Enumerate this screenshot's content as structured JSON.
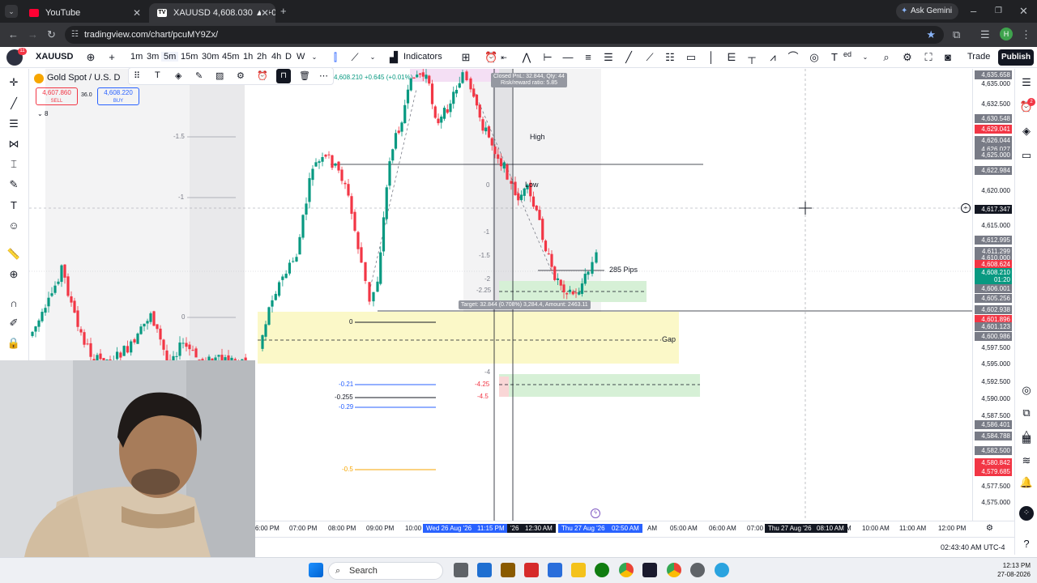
{
  "browser": {
    "tabs": [
      {
        "title": "YouTube",
        "active": false
      },
      {
        "title": "XAUUSD 4,608.030 ▲ +0.29% U",
        "active": true
      }
    ],
    "url": "tradingview.com/chart/pcuMY9Zx/",
    "gemini": "Ask Gemini",
    "profile_initial": "H"
  },
  "toolbar": {
    "symbol": "XAUUSD",
    "timeframes": [
      "1m",
      "3m",
      "5m",
      "15m",
      "30m",
      "45m",
      "1h",
      "2h",
      "4h",
      "D",
      "W"
    ],
    "active_timeframe": "5m",
    "indicators": "Indicators",
    "trade": "Trade",
    "publish": "Publish",
    "partial_label": "ed"
  },
  "legend": {
    "title": "Gold Spot / U.S. D",
    "ohlc_tail": "4,608.210 +0.645 (+0.01%)",
    "sell_price": "4,607.860",
    "sell_label": "SELL",
    "spread": "36.0",
    "buy_price": "4,608.220",
    "buy_label": "BUY",
    "collapse_count": "8"
  },
  "chart": {
    "position_info": [
      "Closed PnL: 32.844, Qty: 44",
      "Risk/reward ratio: 5.85"
    ],
    "target_info": "Target: 32.844 (0.708%) 3,284.4, Amount: 2463.11",
    "labels": {
      "high": "High",
      "low": "Low",
      "pips": "285 Pips",
      "gap": "Gap",
      "partial": "Lo"
    },
    "fib_left": [
      "-1.5",
      "-1",
      "0"
    ],
    "fib_mid": [
      "0",
      "-1",
      "-1.5",
      "-2",
      "-2.25",
      "-4",
      "-4.25",
      "-4.5"
    ],
    "fib_levels": [
      "0",
      "-0.21",
      "-0.255",
      "-0.29",
      "-0.5"
    ],
    "fib_colors": {
      "blue": "#2962ff",
      "black": "#131722",
      "orange": "#f7a600",
      "red": "#f23645"
    }
  },
  "price_axis": {
    "labels": [
      "4,635.658",
      "4,635.000",
      "4,632.500",
      "4,630.548",
      "4,630.000",
      "4,629.041",
      "4,626.044",
      "4,626.027",
      "4,625.000",
      "4,622.984",
      "4,620.000",
      "4,617.347",
      "4,615.000",
      "4,612.995",
      "4,611.299",
      "4,610.000",
      "4,608.624",
      "4,608.210",
      "01:20",
      "4,606.001",
      "4,605.256",
      "4,602.938",
      "4,601.896",
      "4,601.123",
      "4,600.986",
      "4,597.500",
      "4,595.000",
      "4,592.500",
      "4,590.000",
      "4,587.500",
      "4,586.401",
      "4,584.788",
      "4,582.500",
      "4,580.842",
      "4,579.685",
      "4,577.500",
      "4,575.000"
    ]
  },
  "time_axis": {
    "labels": [
      "6:00 PM",
      "07:00 PM",
      "08:00 PM",
      "09:00 PM",
      "10:00",
      "05:00 AM",
      "06:00 AM",
      "07:00",
      "10:00 AM",
      "11:00 AM",
      "12:00 PM"
    ],
    "highlight_1": "Wed 26 Aug '26",
    "highlight_1b": "11:15 PM",
    "highlight_2a": "'26",
    "highlight_2b": "12:30 AM",
    "highlight_3a": "Thu 27 Aug '26",
    "highlight_3b": "02:50 AM",
    "tail_3": "AM",
    "highlight_4": "Thu 27 Aug '26",
    "highlight_4b": "08:10 AM",
    "tail_4": "M"
  },
  "status": {
    "clock": "02:43:40 AM UTC-4"
  },
  "taskbar": {
    "search": "Search",
    "time": "12:13 PM",
    "date": "27-08-2026"
  },
  "badges": {
    "yt_count": "11",
    "sidebar_count": "2"
  }
}
